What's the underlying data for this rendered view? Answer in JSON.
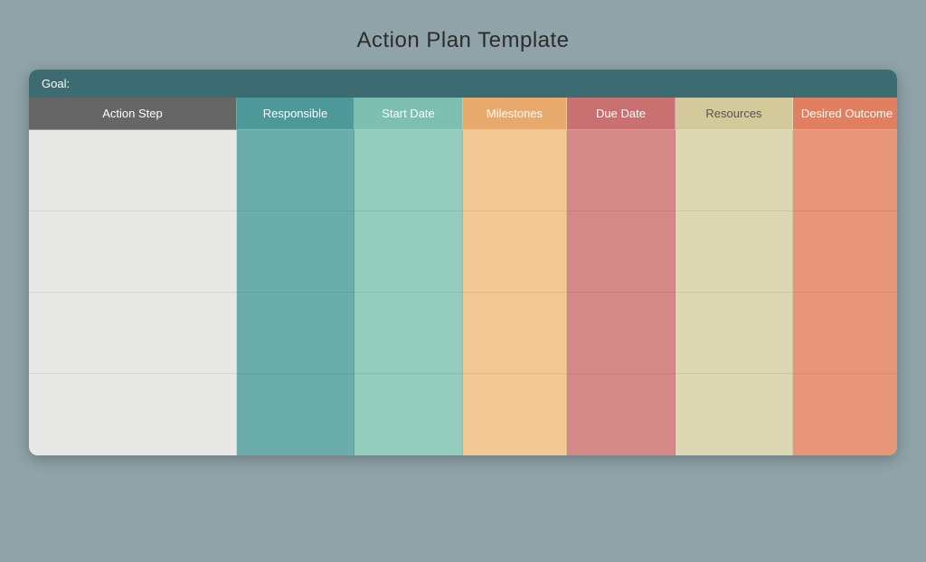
{
  "page": {
    "title": "Action Plan Template",
    "background_color": "#8fa3a8"
  },
  "goal_bar": {
    "label": "Goal:"
  },
  "headers": [
    {
      "id": "action-step",
      "label": "Action Step",
      "class": "header-action-step"
    },
    {
      "id": "responsible",
      "label": "Responsible",
      "class": "header-responsible"
    },
    {
      "id": "start-date",
      "label": "Start Date",
      "class": "header-start-date"
    },
    {
      "id": "milestones",
      "label": "Milestones",
      "class": "header-milestones"
    },
    {
      "id": "due-date",
      "label": "Due Date",
      "class": "header-due-date"
    },
    {
      "id": "resources",
      "label": "Resources",
      "class": "header-resources"
    },
    {
      "id": "desired-outcome",
      "label": "Desired Outcome",
      "class": "header-desired-outcome"
    }
  ],
  "rows": [
    {
      "id": "row-1"
    },
    {
      "id": "row-2"
    },
    {
      "id": "row-3"
    },
    {
      "id": "row-4"
    }
  ],
  "cell_classes": {
    "action-step": "cell-action-step",
    "responsible": "cell-responsible",
    "start-date": "cell-start-date",
    "milestones": "cell-milestones",
    "due-date": "cell-due-date",
    "resources": "cell-resources",
    "desired-outcome": "cell-desired-outcome"
  }
}
